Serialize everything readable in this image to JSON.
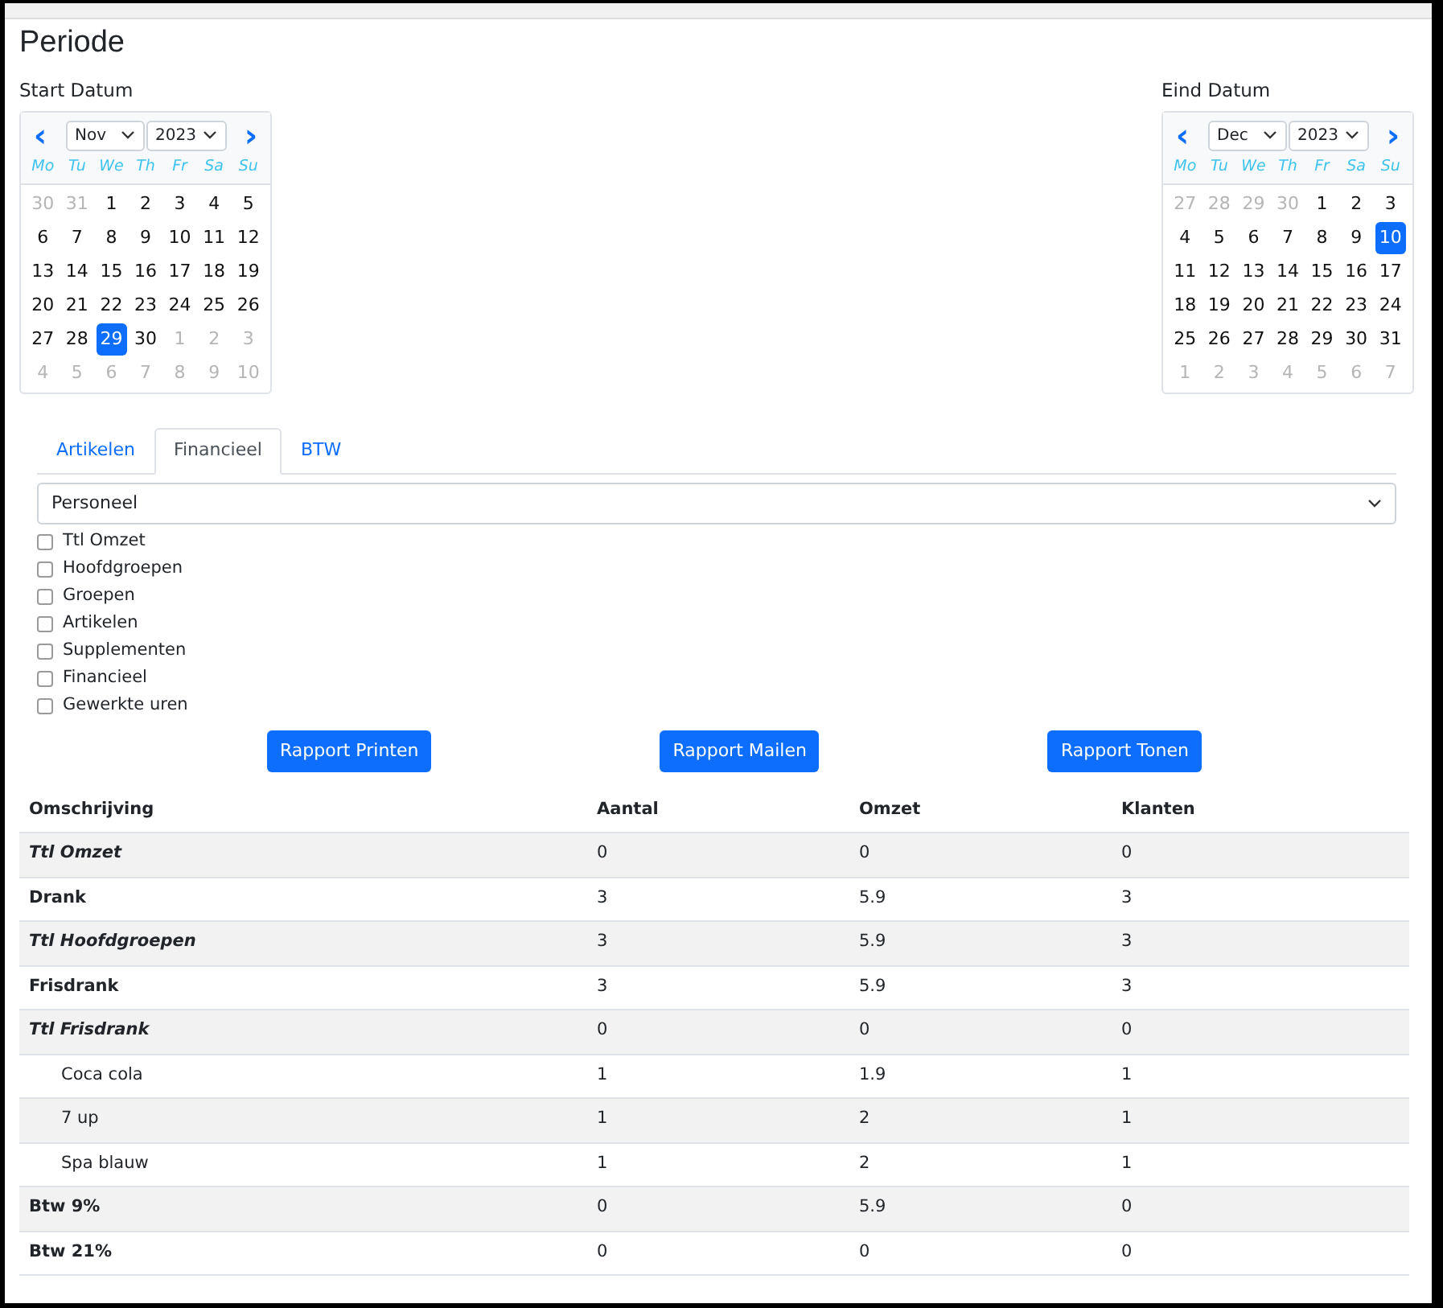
{
  "title": "Periode",
  "calendars": [
    {
      "label": "Start Datum",
      "month": "Nov",
      "year": "2023",
      "prev": "‹",
      "next": "›",
      "weekdays": [
        "Mo",
        "Tu",
        "We",
        "Th",
        "Fr",
        "Sa",
        "Su"
      ],
      "weeks": [
        [
          {
            "day": "30",
            "outside": true,
            "selected": false
          },
          {
            "day": "31",
            "outside": true,
            "selected": false
          },
          {
            "day": "1",
            "outside": false,
            "selected": false
          },
          {
            "day": "2",
            "outside": false,
            "selected": false
          },
          {
            "day": "3",
            "outside": false,
            "selected": false
          },
          {
            "day": "4",
            "outside": false,
            "selected": false
          },
          {
            "day": "5",
            "outside": false,
            "selected": false
          }
        ],
        [
          {
            "day": "6",
            "outside": false,
            "selected": false
          },
          {
            "day": "7",
            "outside": false,
            "selected": false
          },
          {
            "day": "8",
            "outside": false,
            "selected": false
          },
          {
            "day": "9",
            "outside": false,
            "selected": false
          },
          {
            "day": "10",
            "outside": false,
            "selected": false
          },
          {
            "day": "11",
            "outside": false,
            "selected": false
          },
          {
            "day": "12",
            "outside": false,
            "selected": false
          }
        ],
        [
          {
            "day": "13",
            "outside": false,
            "selected": false
          },
          {
            "day": "14",
            "outside": false,
            "selected": false
          },
          {
            "day": "15",
            "outside": false,
            "selected": false
          },
          {
            "day": "16",
            "outside": false,
            "selected": false
          },
          {
            "day": "17",
            "outside": false,
            "selected": false
          },
          {
            "day": "18",
            "outside": false,
            "selected": false
          },
          {
            "day": "19",
            "outside": false,
            "selected": false
          }
        ],
        [
          {
            "day": "20",
            "outside": false,
            "selected": false
          },
          {
            "day": "21",
            "outside": false,
            "selected": false
          },
          {
            "day": "22",
            "outside": false,
            "selected": false
          },
          {
            "day": "23",
            "outside": false,
            "selected": false
          },
          {
            "day": "24",
            "outside": false,
            "selected": false
          },
          {
            "day": "25",
            "outside": false,
            "selected": false
          },
          {
            "day": "26",
            "outside": false,
            "selected": false
          }
        ],
        [
          {
            "day": "27",
            "outside": false,
            "selected": false
          },
          {
            "day": "28",
            "outside": false,
            "selected": false
          },
          {
            "day": "29",
            "outside": false,
            "selected": true
          },
          {
            "day": "30",
            "outside": false,
            "selected": false
          },
          {
            "day": "1",
            "outside": true,
            "selected": false
          },
          {
            "day": "2",
            "outside": true,
            "selected": false
          },
          {
            "day": "3",
            "outside": true,
            "selected": false
          }
        ],
        [
          {
            "day": "4",
            "outside": true,
            "selected": false
          },
          {
            "day": "5",
            "outside": true,
            "selected": false
          },
          {
            "day": "6",
            "outside": true,
            "selected": false
          },
          {
            "day": "7",
            "outside": true,
            "selected": false
          },
          {
            "day": "8",
            "outside": true,
            "selected": false
          },
          {
            "day": "9",
            "outside": true,
            "selected": false
          },
          {
            "day": "10",
            "outside": true,
            "selected": false
          }
        ]
      ]
    },
    {
      "label": "Eind Datum",
      "month": "Dec",
      "year": "2023",
      "prev": "‹",
      "next": "›",
      "weekdays": [
        "Mo",
        "Tu",
        "We",
        "Th",
        "Fr",
        "Sa",
        "Su"
      ],
      "weeks": [
        [
          {
            "day": "27",
            "outside": true,
            "selected": false
          },
          {
            "day": "28",
            "outside": true,
            "selected": false
          },
          {
            "day": "29",
            "outside": true,
            "selected": false
          },
          {
            "day": "30",
            "outside": true,
            "selected": false
          },
          {
            "day": "1",
            "outside": false,
            "selected": false
          },
          {
            "day": "2",
            "outside": false,
            "selected": false
          },
          {
            "day": "3",
            "outside": false,
            "selected": false
          }
        ],
        [
          {
            "day": "4",
            "outside": false,
            "selected": false
          },
          {
            "day": "5",
            "outside": false,
            "selected": false
          },
          {
            "day": "6",
            "outside": false,
            "selected": false
          },
          {
            "day": "7",
            "outside": false,
            "selected": false
          },
          {
            "day": "8",
            "outside": false,
            "selected": false
          },
          {
            "day": "9",
            "outside": false,
            "selected": false
          },
          {
            "day": "10",
            "outside": false,
            "selected": true
          }
        ],
        [
          {
            "day": "11",
            "outside": false,
            "selected": false
          },
          {
            "day": "12",
            "outside": false,
            "selected": false
          },
          {
            "day": "13",
            "outside": false,
            "selected": false
          },
          {
            "day": "14",
            "outside": false,
            "selected": false
          },
          {
            "day": "15",
            "outside": false,
            "selected": false
          },
          {
            "day": "16",
            "outside": false,
            "selected": false
          },
          {
            "day": "17",
            "outside": false,
            "selected": false
          }
        ],
        [
          {
            "day": "18",
            "outside": false,
            "selected": false
          },
          {
            "day": "19",
            "outside": false,
            "selected": false
          },
          {
            "day": "20",
            "outside": false,
            "selected": false
          },
          {
            "day": "21",
            "outside": false,
            "selected": false
          },
          {
            "day": "22",
            "outside": false,
            "selected": false
          },
          {
            "day": "23",
            "outside": false,
            "selected": false
          },
          {
            "day": "24",
            "outside": false,
            "selected": false
          }
        ],
        [
          {
            "day": "25",
            "outside": false,
            "selected": false
          },
          {
            "day": "26",
            "outside": false,
            "selected": false
          },
          {
            "day": "27",
            "outside": false,
            "selected": false
          },
          {
            "day": "28",
            "outside": false,
            "selected": false
          },
          {
            "day": "29",
            "outside": false,
            "selected": false
          },
          {
            "day": "30",
            "outside": false,
            "selected": false
          },
          {
            "day": "31",
            "outside": false,
            "selected": false
          }
        ],
        [
          {
            "day": "1",
            "outside": true,
            "selected": false
          },
          {
            "day": "2",
            "outside": true,
            "selected": false
          },
          {
            "day": "3",
            "outside": true,
            "selected": false
          },
          {
            "day": "4",
            "outside": true,
            "selected": false
          },
          {
            "day": "5",
            "outside": true,
            "selected": false
          },
          {
            "day": "6",
            "outside": true,
            "selected": false
          },
          {
            "day": "7",
            "outside": true,
            "selected": false
          }
        ]
      ]
    }
  ],
  "tabs": [
    {
      "label": "Artikelen",
      "selected": false
    },
    {
      "label": "Financieel",
      "selected": true
    },
    {
      "label": "BTW",
      "selected": false
    }
  ],
  "select": {
    "value": "Personeel"
  },
  "checkboxes": [
    {
      "label": "Ttl Omzet",
      "checked": false
    },
    {
      "label": "Hoofdgroepen",
      "checked": false
    },
    {
      "label": "Groepen",
      "checked": false
    },
    {
      "label": "Artikelen",
      "checked": false
    },
    {
      "label": "Supplementen",
      "checked": false
    },
    {
      "label": "Financieel",
      "checked": false
    },
    {
      "label": "Gewerkte uren",
      "checked": false
    }
  ],
  "buttons": [
    "Rapport Printen",
    "Rapport Mailen",
    "Rapport Tonen"
  ],
  "table": {
    "columns": [
      "Omschrijving",
      "Aantal",
      "Omzet",
      "Klanten"
    ],
    "rows": [
      {
        "kind": "total",
        "cells": [
          "Ttl Omzet",
          "0",
          "0",
          "0"
        ]
      },
      {
        "kind": "group",
        "cells": [
          "Drank",
          "3",
          "5.9",
          "3"
        ]
      },
      {
        "kind": "total",
        "cells": [
          "Ttl Hoofdgroepen",
          "3",
          "5.9",
          "3"
        ]
      },
      {
        "kind": "group",
        "cells": [
          "Frisdrank",
          "3",
          "5.9",
          "3"
        ]
      },
      {
        "kind": "total",
        "cells": [
          "Ttl Frisdrank",
          "0",
          "0",
          "0"
        ]
      },
      {
        "kind": "item",
        "cells": [
          "Coca cola",
          "1",
          "1.9",
          "1"
        ]
      },
      {
        "kind": "item",
        "cells": [
          "7 up",
          "1",
          "2",
          "1"
        ]
      },
      {
        "kind": "item",
        "cells": [
          "Spa blauw",
          "1",
          "2",
          "1"
        ]
      },
      {
        "kind": "group",
        "cells": [
          "Btw 9%",
          "0",
          "5.9",
          "0"
        ]
      },
      {
        "kind": "group",
        "cells": [
          "Btw 21%",
          "0",
          "0",
          "0"
        ]
      }
    ]
  }
}
